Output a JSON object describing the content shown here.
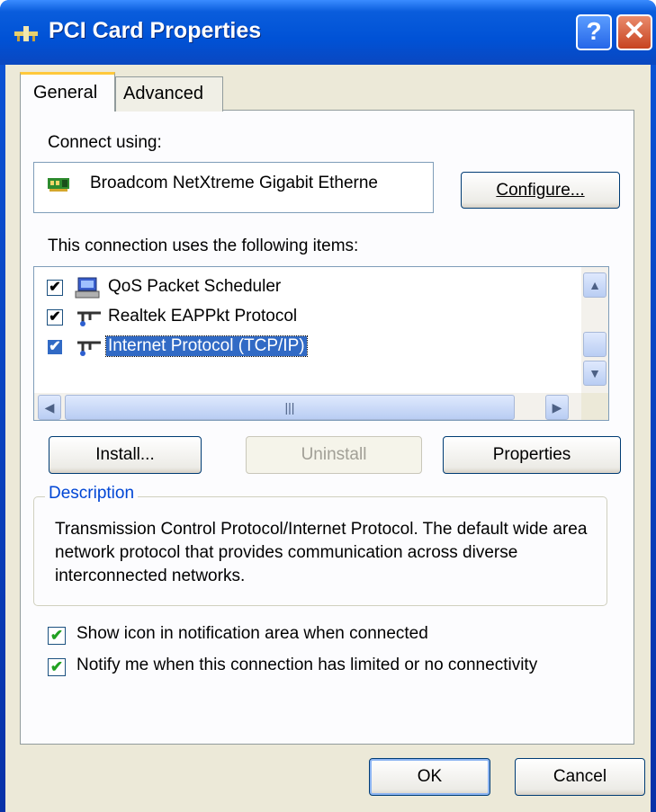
{
  "window": {
    "title": "PCI Card Properties"
  },
  "caption_buttons": {
    "help": "?",
    "close": "✕"
  },
  "tabs": [
    {
      "label": "General"
    },
    {
      "label": "Advanced"
    }
  ],
  "connect_using": {
    "label": "Connect using:",
    "adapter": "Broadcom NetXtreme Gigabit Etherne",
    "configure_button": "Configure..."
  },
  "items": {
    "label": "This connection uses the following items:",
    "list": [
      {
        "label": "QoS Packet Scheduler",
        "checked": true,
        "icon": "scheduler-icon"
      },
      {
        "label": "Realtek EAPPkt Protocol",
        "checked": true,
        "icon": "protocol-icon"
      },
      {
        "label": "Internet Protocol (TCP/IP)",
        "checked": true,
        "icon": "protocol-icon",
        "selected": true
      }
    ],
    "check_mark": "✔"
  },
  "buttons": {
    "install": "Install...",
    "uninstall": "Uninstall",
    "properties": "Properties"
  },
  "description": {
    "title": "Description",
    "text": "Transmission Control Protocol/Internet Protocol. The default wide area network protocol that provides communication across diverse interconnected networks."
  },
  "options": {
    "show_icon": {
      "label": "Show icon in notification area when connected",
      "checked": true
    },
    "notify": {
      "label": "Notify me when this connection has limited or no connectivity",
      "checked": true
    },
    "check_mark": "✔"
  },
  "footer": {
    "ok": "OK",
    "cancel": "Cancel"
  },
  "colors": {
    "title_bar": "#0052d6",
    "dialog_bg": "#ece9d8",
    "selection": "#316ac5",
    "group_title": "#0046d5"
  }
}
